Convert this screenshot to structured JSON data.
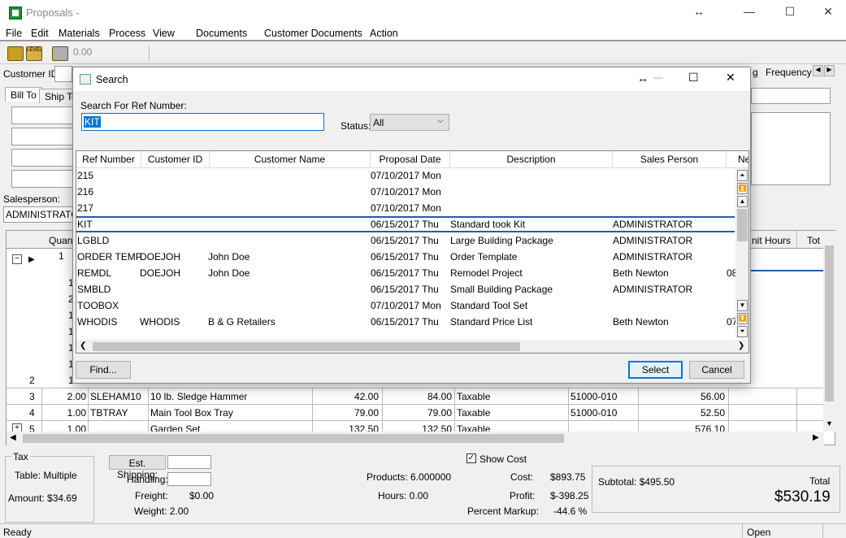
{
  "window": {
    "title": "Proposals -",
    "resize_glyph": "↔",
    "min_glyph": "—",
    "max_glyph": "☐",
    "close_glyph": "✕"
  },
  "menu": [
    "File",
    "Edit",
    "Materials",
    "Process",
    "View",
    "Documents",
    "Customer Documents",
    "Action"
  ],
  "toolbar": {
    "value": "0.00",
    "level_label": "LEVEL"
  },
  "header": {
    "customer_id_label": "Customer ID:",
    "frequency_label": "Frequency",
    "freq_partial": "g"
  },
  "tabs": {
    "bill_to": "Bill To",
    "ship_to": "Ship To"
  },
  "salesperson": {
    "label": "Salesperson:",
    "value": "ADMINISTRATO"
  },
  "grid": {
    "col_quantity": "Quant",
    "col_unit_hours": "nit Hours",
    "col_total": "Tot",
    "partial_rows": [
      {
        "qty": "1"
      },
      {
        "qty": "1"
      },
      {
        "qty": "2"
      },
      {
        "qty": "1"
      },
      {
        "qty": "1"
      },
      {
        "qty": "1"
      },
      {
        "qty": "1"
      }
    ],
    "rows": [
      {
        "num": "2",
        "qty": "1",
        "item": "",
        "desc": "",
        "price": "",
        "ext": "",
        "tax": "",
        "acct": "",
        "hours": ""
      },
      {
        "num": "3",
        "qty": "2.00",
        "item": "SLEHAM10",
        "desc": "10 lb. Sledge Hammer",
        "price": "42.00",
        "ext": "84.00",
        "tax": "Taxable",
        "acct": "51000-010",
        "hours": "56.00"
      },
      {
        "num": "4",
        "qty": "1.00",
        "item": "TBTRAY",
        "desc": "Main Tool Box Tray",
        "price": "79.00",
        "ext": "79.00",
        "tax": "Taxable",
        "acct": "51000-010",
        "hours": "52.50"
      },
      {
        "num": "5",
        "qty": "1.00",
        "item": "",
        "desc": "Garden Set",
        "price": "132.50",
        "ext": "132.50",
        "tax": "Taxable",
        "acct": "",
        "hours": "576.10"
      }
    ]
  },
  "bottom": {
    "tax_group": "Tax",
    "tax_table": "Table: Multiple",
    "tax_amount": "Amount: $34.69",
    "est_shipping": "Est. Shipping:",
    "handling": "Handling:",
    "freight_label": "Freight:",
    "freight_value": "$0.00",
    "weight": "Weight: 2.00",
    "products": "Products: 6.000000",
    "hours": "Hours: 0.00",
    "show_cost": "Show Cost",
    "cost_label": "Cost:",
    "cost_value": "$893.75",
    "profit_label": "Profit:",
    "profit_value": "$-398.25",
    "markup_label": "Percent Markup:",
    "markup_value": "-44.6 %",
    "subtotal": "Subtotal: $495.50",
    "total_label": "Total",
    "total_value": "$530.19"
  },
  "status": {
    "left": "Ready",
    "right": "Open"
  },
  "dialog": {
    "title": "Search",
    "search_label": "Search For Ref Number:",
    "search_value": "KIT",
    "status_label": "Status:",
    "status_value": "All",
    "columns": [
      "Ref Number",
      "Customer ID",
      "Customer Name",
      "Proposal Date",
      "Description",
      "Sales Person",
      "Ne"
    ],
    "rows": [
      {
        "ref": "215",
        "cust_id": "",
        "cust_name": "",
        "date": "07/10/2017 Mon",
        "desc": "",
        "sales": "",
        "ne": ""
      },
      {
        "ref": "216",
        "cust_id": "",
        "cust_name": "",
        "date": "07/10/2017 Mon",
        "desc": "",
        "sales": "",
        "ne": ""
      },
      {
        "ref": "217",
        "cust_id": "",
        "cust_name": "",
        "date": "07/10/2017 Mon",
        "desc": "",
        "sales": "",
        "ne": ""
      },
      {
        "ref": "KIT",
        "cust_id": "",
        "cust_name": "",
        "date": "06/15/2017 Thu",
        "desc": "Standard took Kit",
        "sales": "ADMINISTRATOR",
        "ne": ""
      },
      {
        "ref": "LGBLD",
        "cust_id": "",
        "cust_name": "",
        "date": "06/15/2017 Thu",
        "desc": "Large Building Package",
        "sales": "ADMINISTRATOR",
        "ne": ""
      },
      {
        "ref": "ORDER TEMP",
        "cust_id": "DOEJOH",
        "cust_name": "John Doe",
        "date": "06/15/2017 Thu",
        "desc": "Order Template",
        "sales": "ADMINISTRATOR",
        "ne": ""
      },
      {
        "ref": "REMDL",
        "cust_id": "DOEJOH",
        "cust_name": "John Doe",
        "date": "06/15/2017 Thu",
        "desc": "Remodel Project",
        "sales": "Beth Newton",
        "ne": "08"
      },
      {
        "ref": "SMBLD",
        "cust_id": "",
        "cust_name": "",
        "date": "06/15/2017 Thu",
        "desc": "Small Building Package",
        "sales": "ADMINISTRATOR",
        "ne": ""
      },
      {
        "ref": "TOOBOX",
        "cust_id": "",
        "cust_name": "",
        "date": "07/10/2017 Mon",
        "desc": "Standard Tool Set",
        "sales": "",
        "ne": ""
      },
      {
        "ref": "WHODIS",
        "cust_id": "WHODIS",
        "cust_name": "B & G Retailers",
        "date": "06/15/2017 Thu",
        "desc": "Standard Price List",
        "sales": "Beth Newton",
        "ne": "07"
      }
    ],
    "find_button": "Find...",
    "select_button": "Select",
    "cancel_button": "Cancel"
  }
}
